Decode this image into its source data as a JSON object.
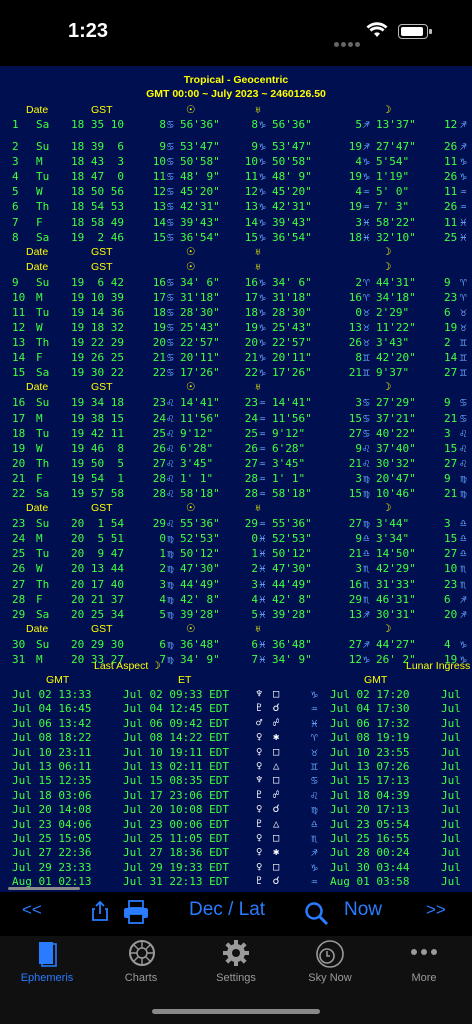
{
  "status": {
    "time": "1:23"
  },
  "header": {
    "line1": "Tropical - Geocentric",
    "line2": "GMT 00:00 ~ July 2023 ~ 2460126.50"
  },
  "col_headers": {
    "date": "Date",
    "gst": "GST",
    "sun": "☉",
    "uranus": "♅",
    "moon": "☽"
  },
  "week_blocks": [
    {
      "rows": [
        {
          "day": "1",
          "dow": "Sa",
          "gst": "18 35 10",
          "p1d": "8",
          "p1s": "♋",
          "p1m": "56'36\"",
          "p2d": "8",
          "p2s": "♑",
          "p2m": "56'36\"",
          "p3d": "5",
          "p3s": "♐",
          "p3m": "13'37\"",
          "p4": "12",
          "p4s": "♐"
        }
      ]
    },
    {
      "rows": [
        {
          "day": "2",
          "dow": "Su",
          "gst": "18 39  6",
          "p1d": "9",
          "p1s": "♋",
          "p1m": "53'47\"",
          "p2d": "9",
          "p2s": "♑",
          "p2m": "53'47\"",
          "p3d": "19",
          "p3s": "♐",
          "p3m": "27'47\"",
          "p4": "26",
          "p4s": "♐"
        },
        {
          "day": "3",
          "dow": "M",
          "gst": "18 43  3",
          "p1d": "10",
          "p1s": "♋",
          "p1m": "50'58\"",
          "p2d": "10",
          "p2s": "♑",
          "p2m": "50'58\"",
          "p3d": "4",
          "p3s": "♑",
          "p3m": "5'54\"",
          "p4": "11",
          "p4s": "♑"
        },
        {
          "day": "4",
          "dow": "Tu",
          "gst": "18 47  0",
          "p1d": "11",
          "p1s": "♋",
          "p1m": "48' 9\"",
          "p2d": "11",
          "p2s": "♑",
          "p2m": "48' 9\"",
          "p3d": "19",
          "p3s": "♑",
          "p3m": "1'19\"",
          "p4": "26",
          "p4s": "♑"
        },
        {
          "day": "5",
          "dow": "W",
          "gst": "18 50 56",
          "p1d": "12",
          "p1s": "♋",
          "p1m": "45'20\"",
          "p2d": "12",
          "p2s": "♑",
          "p2m": "45'20\"",
          "p3d": "4",
          "p3s": "♒",
          "p3m": "5' 0\"",
          "p4": "11",
          "p4s": "♒"
        },
        {
          "day": "6",
          "dow": "Th",
          "gst": "18 54 53",
          "p1d": "13",
          "p1s": "♋",
          "p1m": "42'31\"",
          "p2d": "13",
          "p2s": "♑",
          "p2m": "42'31\"",
          "p3d": "19",
          "p3s": "♒",
          "p3m": "7' 3\"",
          "p4": "26",
          "p4s": "♒"
        },
        {
          "day": "7",
          "dow": "F",
          "gst": "18 58 49",
          "p1d": "14",
          "p1s": "♋",
          "p1m": "39'43\"",
          "p2d": "14",
          "p2s": "♑",
          "p2m": "39'43\"",
          "p3d": "3",
          "p3s": "♓",
          "p3m": "58'22\"",
          "p4": "11",
          "p4s": "♓"
        },
        {
          "day": "8",
          "dow": "Sa",
          "gst": "19  2 46",
          "p1d": "15",
          "p1s": "♋",
          "p1m": "36'54\"",
          "p2d": "15",
          "p2s": "♑",
          "p2m": "36'54\"",
          "p3d": "18",
          "p3s": "♓",
          "p3m": "32'10\"",
          "p4": "25",
          "p4s": "♓"
        }
      ]
    },
    {
      "rows": [
        {
          "day": "9",
          "dow": "Su",
          "gst": "19  6 42",
          "p1d": "16",
          "p1s": "♋",
          "p1m": "34' 6\"",
          "p2d": "16",
          "p2s": "♑",
          "p2m": "34' 6\"",
          "p3d": "2",
          "p3s": "♈",
          "p3m": "44'31\"",
          "p4": "9",
          "p4s": "♈"
        },
        {
          "day": "10",
          "dow": "M",
          "gst": "19 10 39",
          "p1d": "17",
          "p1s": "♋",
          "p1m": "31'18\"",
          "p2d": "17",
          "p2s": "♑",
          "p2m": "31'18\"",
          "p3d": "16",
          "p3s": "♈",
          "p3m": "34'18\"",
          "p4": "23",
          "p4s": "♈"
        },
        {
          "day": "11",
          "dow": "Tu",
          "gst": "19 14 36",
          "p1d": "18",
          "p1s": "♋",
          "p1m": "28'30\"",
          "p2d": "18",
          "p2s": "♑",
          "p2m": "28'30\"",
          "p3d": "0",
          "p3s": "♉",
          "p3m": "2'29\"",
          "p4": "6",
          "p4s": "♉"
        },
        {
          "day": "12",
          "dow": "W",
          "gst": "19 18 32",
          "p1d": "19",
          "p1s": "♋",
          "p1m": "25'43\"",
          "p2d": "19",
          "p2s": "♑",
          "p2m": "25'43\"",
          "p3d": "13",
          "p3s": "♉",
          "p3m": "11'22\"",
          "p4": "19",
          "p4s": "♉"
        },
        {
          "day": "13",
          "dow": "Th",
          "gst": "19 22 29",
          "p1d": "20",
          "p1s": "♋",
          "p1m": "22'57\"",
          "p2d": "20",
          "p2s": "♑",
          "p2m": "22'57\"",
          "p3d": "26",
          "p3s": "♉",
          "p3m": "3'43\"",
          "p4": "2",
          "p4s": "♊"
        },
        {
          "day": "14",
          "dow": "F",
          "gst": "19 26 25",
          "p1d": "21",
          "p1s": "♋",
          "p1m": "20'11\"",
          "p2d": "21",
          "p2s": "♑",
          "p2m": "20'11\"",
          "p3d": "8",
          "p3s": "♊",
          "p3m": "42'20\"",
          "p4": "14",
          "p4s": "♊"
        },
        {
          "day": "15",
          "dow": "Sa",
          "gst": "19 30 22",
          "p1d": "22",
          "p1s": "♋",
          "p1m": "17'26\"",
          "p2d": "22",
          "p2s": "♑",
          "p2m": "17'26\"",
          "p3d": "21",
          "p3s": "♊",
          "p3m": "9'37\"",
          "p4": "27",
          "p4s": "♊"
        }
      ]
    },
    {
      "rows": [
        {
          "day": "16",
          "dow": "Su",
          "gst": "19 34 18",
          "p1d": "23",
          "p1s": "♌",
          "p1m": "14'41\"",
          "p2d": "23",
          "p2s": "♒",
          "p2m": "14'41\"",
          "p3d": "3",
          "p3s": "♋",
          "p3m": "27'29\"",
          "p4": "9",
          "p4s": "♋"
        },
        {
          "day": "17",
          "dow": "M",
          "gst": "19 38 15",
          "p1d": "24",
          "p1s": "♌",
          "p1m": "11'56\"",
          "p2d": "24",
          "p2s": "♒",
          "p2m": "11'56\"",
          "p3d": "15",
          "p3s": "♋",
          "p3m": "37'21\"",
          "p4": "21",
          "p4s": "♋"
        },
        {
          "day": "18",
          "dow": "Tu",
          "gst": "19 42 11",
          "p1d": "25",
          "p1s": "♌",
          "p1m": "9'12\"",
          "p2d": "25",
          "p2s": "♒",
          "p2m": "9'12\"",
          "p3d": "27",
          "p3s": "♋",
          "p3m": "40'22\"",
          "p4": "3",
          "p4s": "♌"
        },
        {
          "day": "19",
          "dow": "W",
          "gst": "19 46  8",
          "p1d": "26",
          "p1s": "♌",
          "p1m": "6'28\"",
          "p2d": "26",
          "p2s": "♒",
          "p2m": "6'28\"",
          "p3d": "9",
          "p3s": "♌",
          "p3m": "37'40\"",
          "p4": "15",
          "p4s": "♌"
        },
        {
          "day": "20",
          "dow": "Th",
          "gst": "19 50  5",
          "p1d": "27",
          "p1s": "♌",
          "p1m": "3'45\"",
          "p2d": "27",
          "p2s": "♒",
          "p2m": "3'45\"",
          "p3d": "21",
          "p3s": "♌",
          "p3m": "30'32\"",
          "p4": "27",
          "p4s": "♌"
        },
        {
          "day": "21",
          "dow": "F",
          "gst": "19 54  1",
          "p1d": "28",
          "p1s": "♌",
          "p1m": "1' 1\"",
          "p2d": "28",
          "p2s": "♒",
          "p2m": "1' 1\"",
          "p3d": "3",
          "p3s": "♍",
          "p3m": "20'47\"",
          "p4": "9",
          "p4s": "♍"
        },
        {
          "day": "22",
          "dow": "Sa",
          "gst": "19 57 58",
          "p1d": "28",
          "p1s": "♌",
          "p1m": "58'18\"",
          "p2d": "28",
          "p2s": "♒",
          "p2m": "58'18\"",
          "p3d": "15",
          "p3s": "♍",
          "p3m": "10'46\"",
          "p4": "21",
          "p4s": "♍"
        }
      ]
    },
    {
      "rows": [
        {
          "day": "23",
          "dow": "Su",
          "gst": "20  1 54",
          "p1d": "29",
          "p1s": "♌",
          "p1m": "55'36\"",
          "p2d": "29",
          "p2s": "♒",
          "p2m": "55'36\"",
          "p3d": "27",
          "p3s": "♍",
          "p3m": "3'44\"",
          "p4": "3",
          "p4s": "♎"
        },
        {
          "day": "24",
          "dow": "M",
          "gst": "20  5 51",
          "p1d": "0",
          "p1s": "♍",
          "p1m": "52'53\"",
          "p2d": "0",
          "p2s": "♓",
          "p2m": "52'53\"",
          "p3d": "9",
          "p3s": "♎",
          "p3m": "3'34\"",
          "p4": "15",
          "p4s": "♎"
        },
        {
          "day": "25",
          "dow": "Tu",
          "gst": "20  9 47",
          "p1d": "1",
          "p1s": "♍",
          "p1m": "50'12\"",
          "p2d": "1",
          "p2s": "♓",
          "p2m": "50'12\"",
          "p3d": "21",
          "p3s": "♎",
          "p3m": "14'50\"",
          "p4": "27",
          "p4s": "♎"
        },
        {
          "day": "26",
          "dow": "W",
          "gst": "20 13 44",
          "p1d": "2",
          "p1s": "♍",
          "p1m": "47'30\"",
          "p2d": "2",
          "p2s": "♓",
          "p2m": "47'30\"",
          "p3d": "3",
          "p3s": "♏",
          "p3m": "42'29\"",
          "p4": "10",
          "p4s": "♏"
        },
        {
          "day": "27",
          "dow": "Th",
          "gst": "20 17 40",
          "p1d": "3",
          "p1s": "♍",
          "p1m": "44'49\"",
          "p2d": "3",
          "p2s": "♓",
          "p2m": "44'49\"",
          "p3d": "16",
          "p3s": "♏",
          "p3m": "31'33\"",
          "p4": "23",
          "p4s": "♏"
        },
        {
          "day": "28",
          "dow": "F",
          "gst": "20 21 37",
          "p1d": "4",
          "p1s": "♍",
          "p1m": "42' 8\"",
          "p2d": "4",
          "p2s": "♓",
          "p2m": "42' 8\"",
          "p3d": "29",
          "p3s": "♏",
          "p3m": "46'31\"",
          "p4": "6",
          "p4s": "♐"
        },
        {
          "day": "29",
          "dow": "Sa",
          "gst": "20 25 34",
          "p1d": "5",
          "p1s": "♍",
          "p1m": "39'28\"",
          "p2d": "5",
          "p2s": "♓",
          "p2m": "39'28\"",
          "p3d": "13",
          "p3s": "♐",
          "p3m": "30'31\"",
          "p4": "20",
          "p4s": "♐"
        }
      ]
    },
    {
      "rows": [
        {
          "day": "30",
          "dow": "Su",
          "gst": "20 29 30",
          "p1d": "6",
          "p1s": "♍",
          "p1m": "36'48\"",
          "p2d": "6",
          "p2s": "♓",
          "p2m": "36'48\"",
          "p3d": "27",
          "p3s": "♐",
          "p3m": "44'27\"",
          "p4": "4",
          "p4s": "♑"
        },
        {
          "day": "31",
          "dow": "M",
          "gst": "20 33 27",
          "p1d": "7",
          "p1s": "♍",
          "p1m": "34' 9\"",
          "p2d": "7",
          "p2s": "♓",
          "p2m": "34' 9\"",
          "p3d": "12",
          "p3s": "♑",
          "p3m": "26' 2\"",
          "p4": "19",
          "p4s": "♑"
        }
      ]
    }
  ],
  "aspects": {
    "title_left": "Last Aspect ☽",
    "title_right": "Lunar Ingress",
    "col_gmt": "GMT",
    "col_et": "ET",
    "col_gmt2": "GMT",
    "rows": [
      {
        "gmt": "Jul 02 13:33",
        "et": "Jul 02 09:33 EDT",
        "pl": "♆",
        "asp": "□",
        "sign": "♑",
        "ing": "Jul 02 17:20",
        "et2": "Jul"
      },
      {
        "gmt": "Jul 04 16:45",
        "et": "Jul 04 12:45 EDT",
        "pl": "♇",
        "asp": "☌",
        "sign": "♒",
        "ing": "Jul 04 17:30",
        "et2": "Jul"
      },
      {
        "gmt": "Jul 06 13:42",
        "et": "Jul 06 09:42 EDT",
        "pl": "♂",
        "asp": "☍",
        "sign": "♓",
        "ing": "Jul 06 17:32",
        "et2": "Jul"
      },
      {
        "gmt": "Jul 08 18:22",
        "et": "Jul 08 14:22 EDT",
        "pl": "♀",
        "asp": "✱",
        "sign": "♈",
        "ing": "Jul 08 19:19",
        "et2": "Jul"
      },
      {
        "gmt": "Jul 10 23:11",
        "et": "Jul 10 19:11 EDT",
        "pl": "♀",
        "asp": "□",
        "sign": "♉",
        "ing": "Jul 10 23:55",
        "et2": "Jul"
      },
      {
        "gmt": "Jul 13 06:11",
        "et": "Jul 13 02:11 EDT",
        "pl": "♀",
        "asp": "△",
        "sign": "♊",
        "ing": "Jul 13 07:26",
        "et2": "Jul"
      },
      {
        "gmt": "Jul 15 12:35",
        "et": "Jul 15 08:35 EDT",
        "pl": "♆",
        "asp": "□",
        "sign": "♋",
        "ing": "Jul 15 17:13",
        "et2": "Jul"
      },
      {
        "gmt": "Jul 18 03:06",
        "et": "Jul 17 23:06 EDT",
        "pl": "♇",
        "asp": "☍",
        "sign": "♌",
        "ing": "Jul 18 04:39",
        "et2": "Jul"
      },
      {
        "gmt": "Jul 20 14:08",
        "et": "Jul 20 10:08 EDT",
        "pl": "♀",
        "asp": "☌",
        "sign": "♍",
        "ing": "Jul 20 17:13",
        "et2": "Jul"
      },
      {
        "gmt": "Jul 23 04:06",
        "et": "Jul 23 00:06 EDT",
        "pl": "♇",
        "asp": "△",
        "sign": "♎",
        "ing": "Jul 23 05:54",
        "et2": "Jul"
      },
      {
        "gmt": "Jul 25 15:05",
        "et": "Jul 25 11:05 EDT",
        "pl": "♀",
        "asp": "□",
        "sign": "♏",
        "ing": "Jul 25 16:55",
        "et2": "Jul"
      },
      {
        "gmt": "Jul 27 22:36",
        "et": "Jul 27 18:36 EDT",
        "pl": "♀",
        "asp": "✱",
        "sign": "♐",
        "ing": "Jul 28 00:24",
        "et2": "Jul"
      },
      {
        "gmt": "Jul 29 23:33",
        "et": "Jul 29 19:33 EDT",
        "pl": "♀",
        "asp": "□",
        "sign": "♑",
        "ing": "Jul 30 03:44",
        "et2": "Jul"
      },
      {
        "gmt": "Aug 01 02:13",
        "et": "Jul 31 22:13 EDT",
        "pl": "♇",
        "asp": "☌",
        "sign": "♒",
        "ing": "Aug 01 03:58",
        "et2": "Jul"
      }
    ]
  },
  "toolbar": {
    "prev": "<<",
    "mode": "Dec / Lat",
    "now": "Now",
    "next": ">>"
  },
  "tabs": [
    {
      "label": "Ephemeris",
      "icon": "book-icon",
      "active": true
    },
    {
      "label": "Charts",
      "icon": "chart-wheel-icon",
      "active": false
    },
    {
      "label": "Settings",
      "icon": "gear-icon",
      "active": false
    },
    {
      "label": "Sky Now",
      "icon": "sky-clock-icon",
      "active": false
    },
    {
      "label": "More",
      "icon": "more-icon",
      "active": false
    }
  ],
  "colors": {
    "background": "#000f50",
    "header": "#ffff00",
    "values": "#40ff40",
    "signs": "#6aa8ff",
    "accent": "#2a7cff"
  }
}
